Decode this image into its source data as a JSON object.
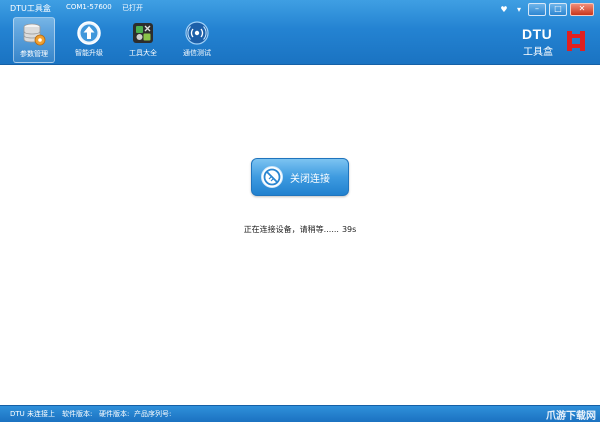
{
  "window": {
    "title": "DTU工具盒",
    "port": "COM1-57600",
    "port_status": "已打开",
    "controls": {
      "minimize": "–",
      "maximize": "□",
      "close": "✕"
    }
  },
  "toolbar": {
    "items": [
      {
        "label": "参数管理",
        "icon": "database-settings-icon",
        "active": true
      },
      {
        "label": "智能升级",
        "icon": "upgrade-arrow-icon",
        "active": false
      },
      {
        "label": "工具大全",
        "icon": "toolbox-icon",
        "active": false
      },
      {
        "label": "通信测试",
        "icon": "signal-test-icon",
        "active": false
      }
    ]
  },
  "brand": {
    "name": "DTU",
    "subtitle": "工具盒"
  },
  "main": {
    "button_label": "关闭连接",
    "status_message": "正在连接设备，请稍等......",
    "countdown": "39s"
  },
  "statusbar": {
    "connection": "DTU 未连接上",
    "software_version": "软件版本:",
    "hardware_version": "硬件版本:",
    "serial_number": "产品序列号:",
    "watermark": "爪游下载网"
  },
  "colors": {
    "header_blue": "#2483d2",
    "button_blue": "#3e9be0",
    "logo_red": "#e02020"
  }
}
